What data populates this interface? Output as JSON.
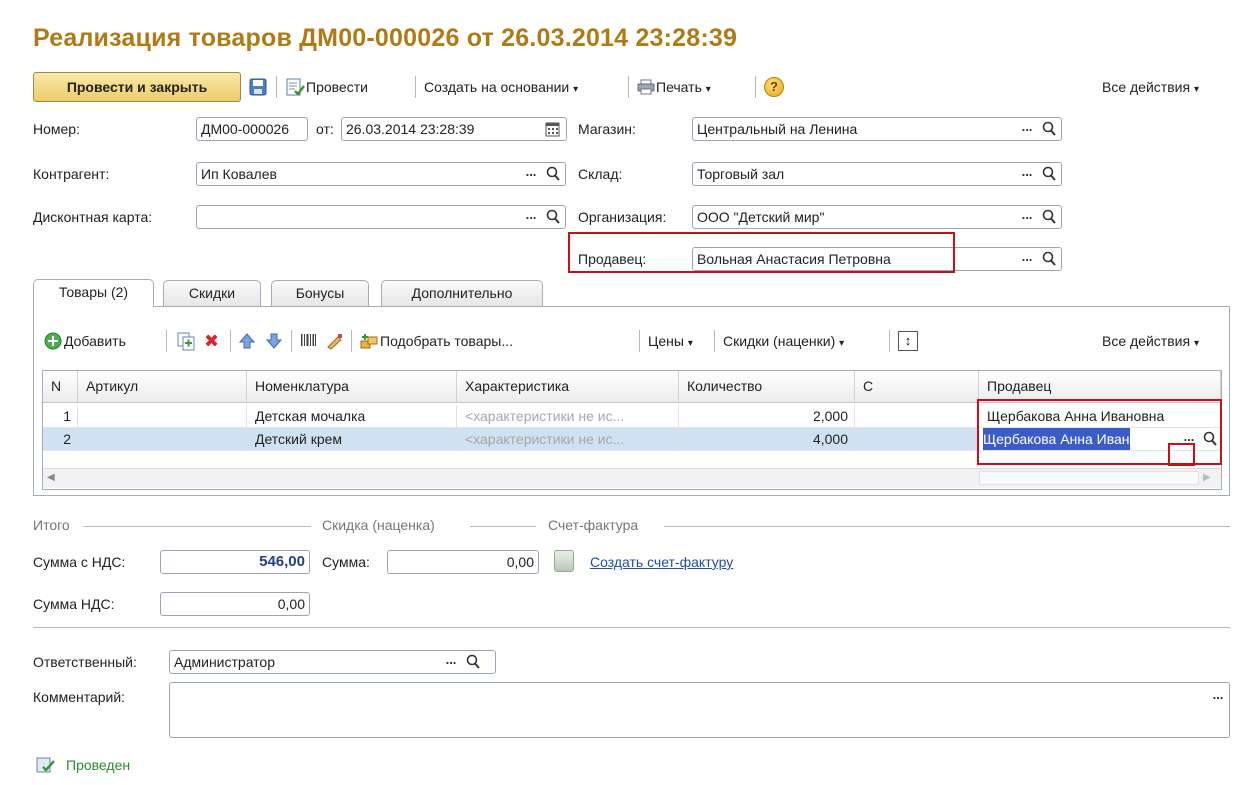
{
  "title": "Реализация товаров ДМ00-000026 от 26.03.2014 23:28:39",
  "toolbar": {
    "post_close": "Провести и закрыть",
    "post": "Провести",
    "create_based": "Создать на основании",
    "print": "Печать",
    "help": "?",
    "all_actions": "Все действия"
  },
  "header": {
    "number_label": "Номер:",
    "number_value": "ДМ00-000026",
    "date_label": "от:",
    "date_value": "26.03.2014 23:28:39",
    "store_label": "Магазин:",
    "store_value": "Центральный на Ленина",
    "counterparty_label": "Контрагент:",
    "counterparty_value": "Ип Ковалев",
    "warehouse_label": "Склад:",
    "warehouse_value": "Торговый зал",
    "card_label": "Дисконтная карта:",
    "card_value": "",
    "org_label": "Организация:",
    "org_value": "ООО \"Детский мир\"",
    "seller_label": "Продавец:",
    "seller_value": "Вольная Анастасия Петровна"
  },
  "tabs": [
    "Товары (2)",
    "Скидки",
    "Бонусы",
    "Дополнительно"
  ],
  "table_toolbar": {
    "add": "Добавить",
    "pick": "Подобрать товары...",
    "prices": "Цены",
    "discounts": "Скидки (наценки)",
    "all_actions": "Все действия"
  },
  "table": {
    "columns": [
      "N",
      "Артикул",
      "Номенклатура",
      "Характеристика",
      "Количество",
      "С",
      "Продавец"
    ],
    "rows": [
      {
        "n": "1",
        "article": "",
        "item": "Детская мочалка",
        "spec": "<характеристики не ис...",
        "qty": "2,000",
        "seller": "Щербакова Анна Ивановна"
      },
      {
        "n": "2",
        "article": "",
        "item": "Детский крем",
        "spec": "<характеристики не ис...",
        "qty": "4,000",
        "seller": "Щербакова Анна Иван"
      }
    ]
  },
  "totals": {
    "section": "Итого",
    "sum_vat_label": "Сумма с НДС:",
    "sum_vat_value": "546,00",
    "vat_label": "Сумма НДС:",
    "vat_value": "0,00",
    "discount_section": "Скидка (наценка)",
    "discount_sum_label": "Сумма:",
    "discount_sum_value": "0,00",
    "invoice_section": "Счет-фактура",
    "invoice_link": "Создать счет-фактуру"
  },
  "footer": {
    "responsible_label": "Ответственный:",
    "responsible_value": "Администратор",
    "comment_label": "Комментарий:",
    "comment_value": "",
    "status": "Проведен"
  },
  "colors": {
    "title": "#b07a15",
    "highlight": "#cc0f17",
    "selection": "#3b5cc4",
    "row_selected": "#cfe2f3"
  }
}
